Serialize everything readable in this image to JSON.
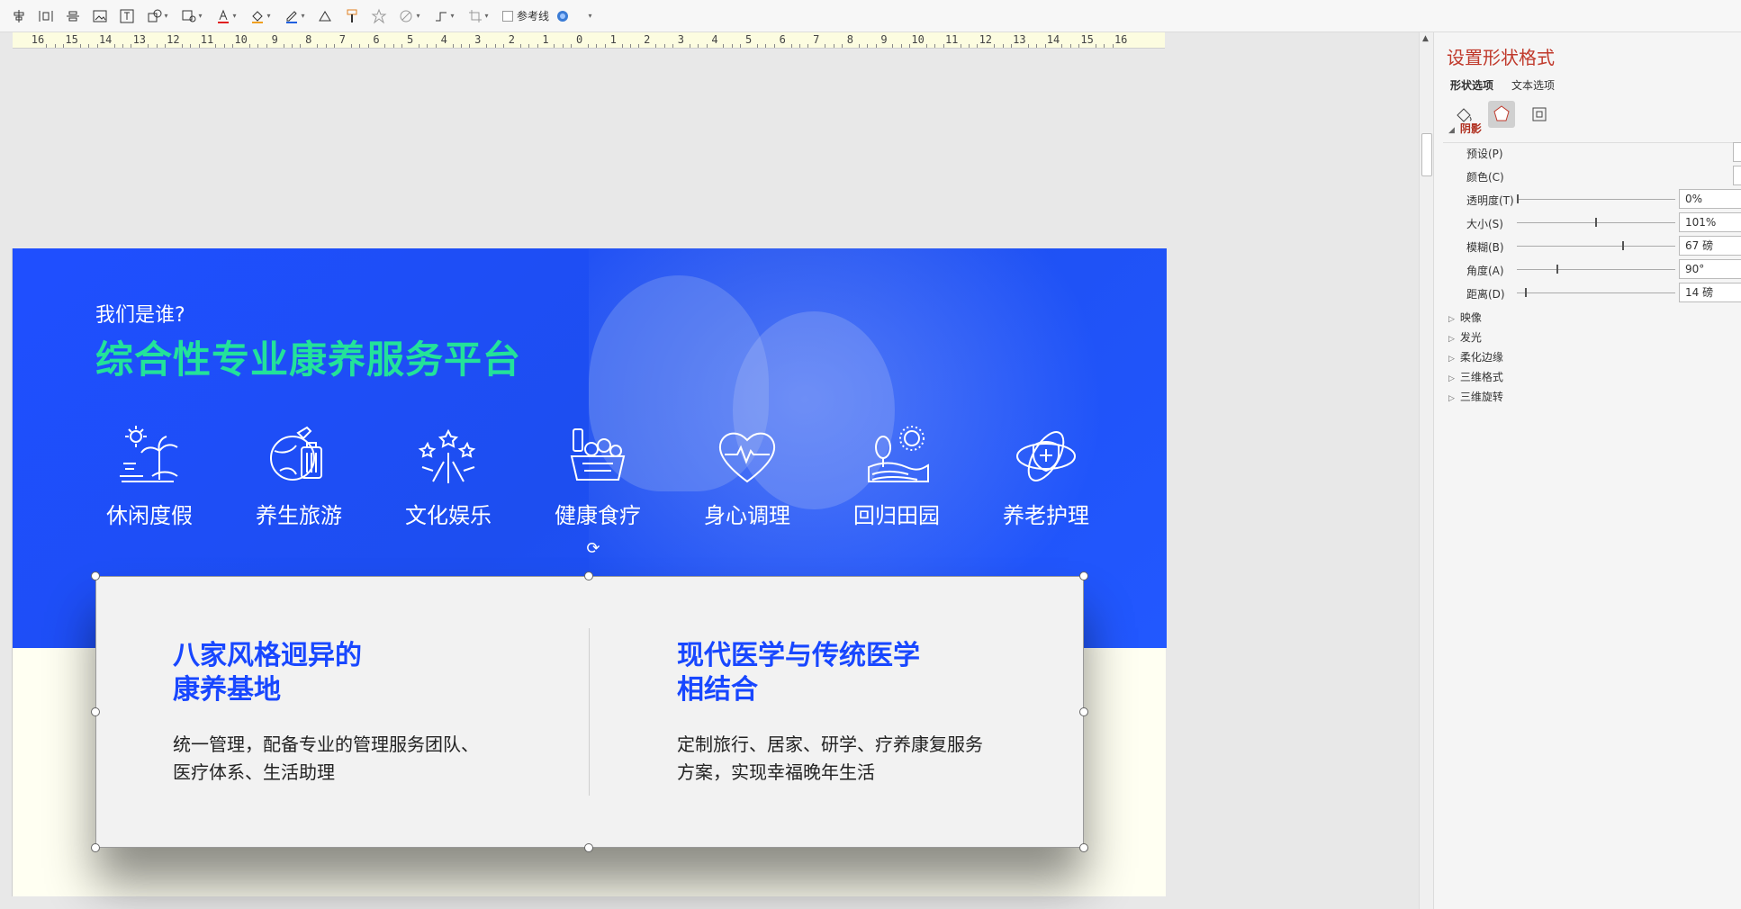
{
  "toolbar": {
    "icons": [
      "align-center-icon",
      "distribute-icon",
      "align-middle-icon",
      "image-frame-icon",
      "text-box-icon",
      "shape-icon",
      "shape-edit-icon",
      "font-color-icon",
      "fill-color-icon",
      "outline-color-icon",
      "format-icon",
      "format-painter-icon",
      "star-icon",
      "shape-effect-icon",
      "connector-icon",
      "crop-icon"
    ],
    "guides_label": "参考线"
  },
  "ruler": {
    "numbers": [
      "16",
      "15",
      "14",
      "13",
      "12",
      "11",
      "10",
      "9",
      "8",
      "7",
      "6",
      "5",
      "4",
      "3",
      "2",
      "1",
      "0",
      "1",
      "2",
      "3",
      "4",
      "5",
      "6",
      "7",
      "8",
      "9",
      "10",
      "11",
      "12",
      "13",
      "14",
      "15",
      "16"
    ]
  },
  "slide": {
    "subtitle": "我们是谁?",
    "title": "综合性专业康养服务平台",
    "title_color": "#23e29a",
    "hero_color": "#1f4fff",
    "services": [
      {
        "label": "休闲度假",
        "icon": "beach-icon"
      },
      {
        "label": "养生旅游",
        "icon": "globe-luggage-icon"
      },
      {
        "label": "文化娱乐",
        "icon": "fireworks-icon"
      },
      {
        "label": "健康食疗",
        "icon": "food-basket-icon"
      },
      {
        "label": "身心调理",
        "icon": "heartbeat-icon"
      },
      {
        "label": "回归田园",
        "icon": "countryside-icon"
      },
      {
        "label": "养老护理",
        "icon": "medical-care-icon"
      }
    ],
    "card": {
      "left": {
        "heading_line1": "八家风格迥异的",
        "heading_line2": "康养基地",
        "text_line1": "统一管理，配备专业的管理服务团队、",
        "text_line2": "医疗体系、生活助理"
      },
      "right": {
        "heading_line1": "现代医学与传统医学",
        "heading_line2": "相结合",
        "text_line1": "定制旅行、居家、研学、疗养康复服务",
        "text_line2": "方案，实现幸福晚年生活"
      },
      "heading_color": "#1847ff"
    }
  },
  "panel": {
    "title": "设置形状格式",
    "tabs": [
      "形状选项",
      "文本选项"
    ],
    "shadow_section": "阴影",
    "rows": [
      {
        "label": "预设(P)",
        "type": "dropdown"
      },
      {
        "label": "颜色(C)",
        "type": "dropdown"
      },
      {
        "label": "透明度(T)",
        "value": "0%",
        "level": 0
      },
      {
        "label": "大小(S)",
        "value": "101%",
        "level": 0.5
      },
      {
        "label": "模糊(B)",
        "value": "67 磅",
        "level": 0.67
      },
      {
        "label": "角度(A)",
        "value": "90°",
        "level": 0.25
      },
      {
        "label": "距离(D)",
        "value": "14 磅",
        "level": 0.05
      }
    ],
    "collapsed_sections": [
      "映像",
      "发光",
      "柔化边缘",
      "三维格式",
      "三维旋转"
    ]
  }
}
